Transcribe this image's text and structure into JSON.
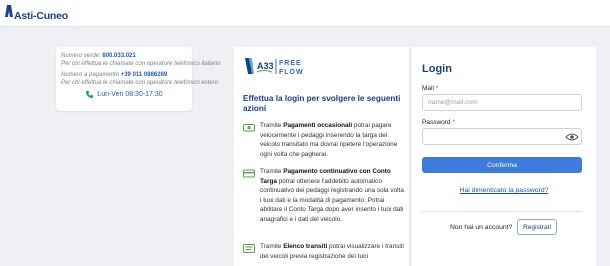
{
  "header": {
    "logo_text": "Asti-Cuneo",
    "logo_icon": "asti-cuneo-logo-mark"
  },
  "contact": {
    "green_label": "Numero verde:",
    "green_number": "800.033.021",
    "green_note": "Per chi effettua le chiamate con operatore telefonico italiano",
    "paid_label": "Numero a pagamento",
    "paid_number": "+39 011 0886269",
    "paid_note": "Per chi effettua le chiamate con operatore telefonico estero",
    "hours": "Lun-Ven  08:30-17:30",
    "hours_icon": "phone-icon"
  },
  "brand": {
    "code": "A33",
    "name_top": "FREE",
    "name_bottom": "FLOW"
  },
  "intro": {
    "title": "Effettua la login per svolgere le seguenti azioni"
  },
  "features": [
    {
      "icon": "cash-icon",
      "bold": "Pagamenti occasionali",
      "prefix": "Tramite ",
      "text": " potrai pagare velocemente i pedaggi inserendo la targa del veicolo transitato ma dovrai ripetere l'operazione ogni volta che pagherai."
    },
    {
      "icon": "card-icon",
      "bold": "Pagamento continuativo con Conto Targa",
      "prefix": "Tramite ",
      "text": " potrai ottenere l'addebito automatico continuativo dei pedaggi registrando una sola volta i tuoi dati e la modalità di pagamento. Potrai abilitare il Conto Targa dopo aver inserito i tuoi dati anagrafici e i dati del veicolo."
    },
    {
      "icon": "list-icon",
      "bold": "Elenco transiti",
      "prefix": "Tramite ",
      "text": " potrai visualizzare i transiti dei veicoli previa registrazione dei tuoi"
    }
  ],
  "login": {
    "title": "Login",
    "mail_label": "Mail",
    "mail_placeholder": "name@mail.com",
    "password_label": "Password",
    "required_mark": "*",
    "confirm": "Conferma",
    "forgot": "Hai dimenticato la password?",
    "no_account": "Non hai un account?",
    "register": "Registrati"
  },
  "colors": {
    "brand_blue": "#1a3f8f",
    "button_blue": "#3d7bdc",
    "feature_green": "#5aa54a",
    "page_bg": "#eef0f3"
  }
}
